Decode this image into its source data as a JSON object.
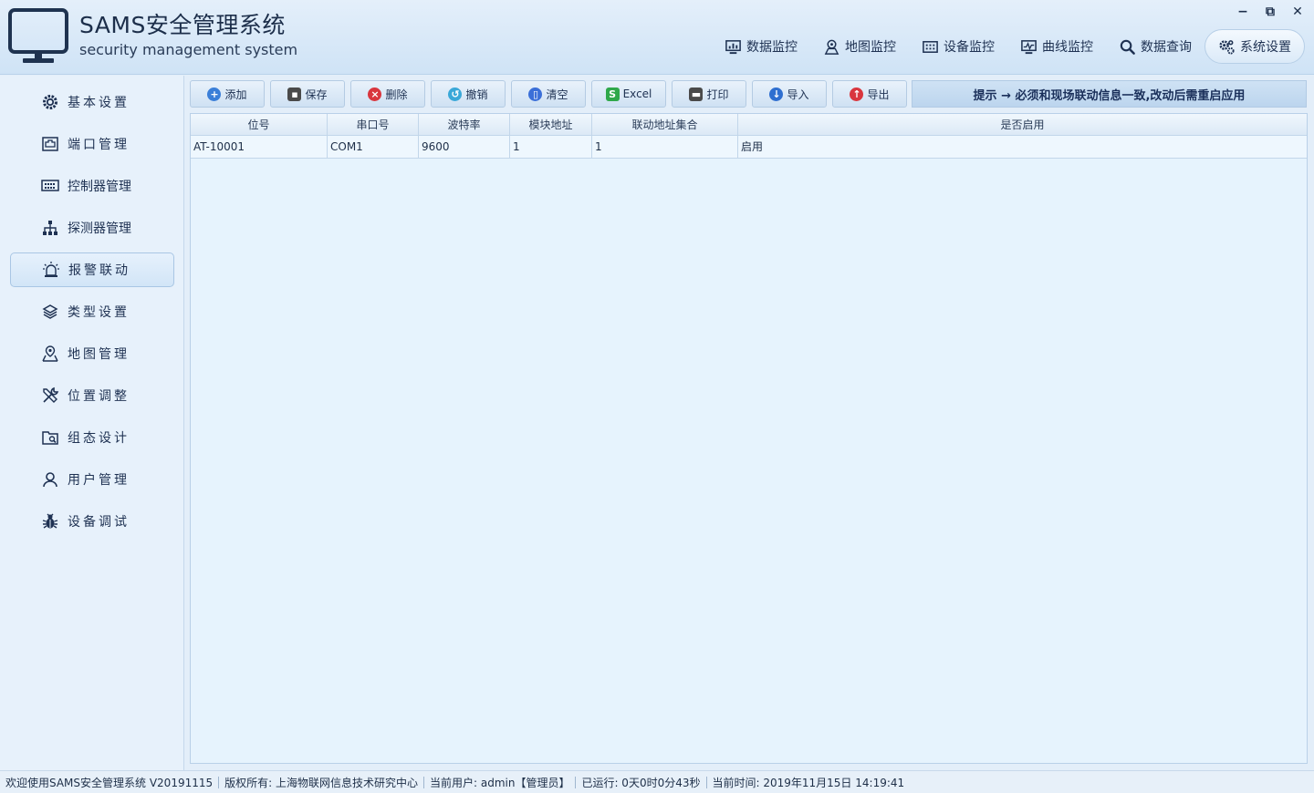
{
  "header": {
    "title": "SAMS安全管理系统",
    "subtitle": "security management system",
    "window_controls": {
      "minimize": "−",
      "restore": "⧉",
      "close": "✕"
    }
  },
  "topnav": [
    {
      "label": "数据监控",
      "icon": "chart-monitor-icon",
      "active": false
    },
    {
      "label": "地图监控",
      "icon": "map-pin-icon",
      "active": false
    },
    {
      "label": "设备监控",
      "icon": "device-grid-icon",
      "active": false
    },
    {
      "label": "曲线监控",
      "icon": "curve-monitor-icon",
      "active": false
    },
    {
      "label": "数据查询",
      "icon": "search-icon",
      "active": false
    },
    {
      "label": "系统设置",
      "icon": "gears-icon",
      "active": true
    }
  ],
  "sidebar": {
    "items": [
      {
        "label": "基本设置",
        "icon": "gear-icon",
        "active": false
      },
      {
        "label": "端口管理",
        "icon": "port-icon",
        "active": false
      },
      {
        "label": "控制器管理",
        "icon": "controller-icon",
        "active": false
      },
      {
        "label": "探测器管理",
        "icon": "network-tree-icon",
        "active": false
      },
      {
        "label": "报警联动",
        "icon": "alarm-light-icon",
        "active": true
      },
      {
        "label": "类型设置",
        "icon": "layers-icon",
        "active": false
      },
      {
        "label": "地图管理",
        "icon": "map-marker-icon",
        "active": false
      },
      {
        "label": "位置调整",
        "icon": "tools-icon",
        "active": false
      },
      {
        "label": "组态设计",
        "icon": "design-folder-icon",
        "active": false
      },
      {
        "label": "用户管理",
        "icon": "user-icon",
        "active": false
      },
      {
        "label": "设备调试",
        "icon": "bug-icon",
        "active": false
      }
    ]
  },
  "toolbar": {
    "buttons": [
      {
        "label": "添加",
        "icon": "add-icon",
        "color": "#3b7fd8"
      },
      {
        "label": "保存",
        "icon": "save-icon",
        "color": "#4a4a4a"
      },
      {
        "label": "删除",
        "icon": "delete-icon",
        "color": "#d9363e"
      },
      {
        "label": "撤销",
        "icon": "undo-icon",
        "color": "#3aa8d8"
      },
      {
        "label": "清空",
        "icon": "trash-icon",
        "color": "#3b6fd8"
      },
      {
        "label": "Excel",
        "icon": "excel-icon",
        "color": "#2fa84a"
      },
      {
        "label": "打印",
        "icon": "printer-icon",
        "color": "#4a4a4a"
      },
      {
        "label": "导入",
        "icon": "import-icon",
        "color": "#2f6fd0"
      },
      {
        "label": "导出",
        "icon": "export-icon",
        "color": "#d9363e"
      }
    ],
    "tip": "提示 → 必须和现场联动信息一致,改动后需重启应用"
  },
  "table": {
    "columns": [
      "位号",
      "串口号",
      "波特率",
      "模块地址",
      "联动地址集合",
      "是否启用"
    ],
    "rows": [
      [
        "AT-10001",
        "COM1",
        "9600",
        "1",
        "1",
        "启用"
      ]
    ]
  },
  "statusbar": {
    "welcome": "欢迎使用SAMS安全管理系统 V20191115",
    "copyright": "版权所有: 上海物联网信息技术研究中心",
    "current_user": "当前用户: admin【管理员】",
    "uptime": "已运行: 0天0时0分43秒",
    "current_time": "当前时间: 2019年11月15日 14:19:41"
  }
}
